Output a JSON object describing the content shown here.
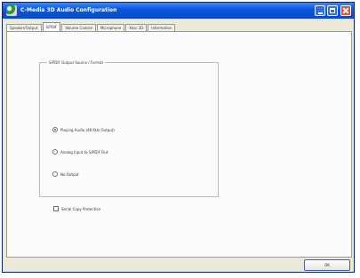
{
  "window": {
    "title": "C-Media 3D Audio Configuration"
  },
  "tabs": [
    {
      "label": "Speaker/Output"
    },
    {
      "label": "S/PDIF"
    },
    {
      "label": "Volume Control"
    },
    {
      "label": "Microphone"
    },
    {
      "label": "Xear 3D"
    },
    {
      "label": "Information"
    }
  ],
  "active_tab": "S/PDIF",
  "group": {
    "title": "S/PDIF Output Source / Format",
    "options": [
      {
        "label": "Playing Audio (48 KHz Output)",
        "checked": true
      },
      {
        "label": "Analog Input to S/PDIF Out",
        "checked": false
      },
      {
        "label": "No Output",
        "checked": false
      }
    ]
  },
  "copy_protection": {
    "label": "Serial Copy Protection",
    "checked": false
  },
  "buttons": {
    "ok": "OK"
  }
}
